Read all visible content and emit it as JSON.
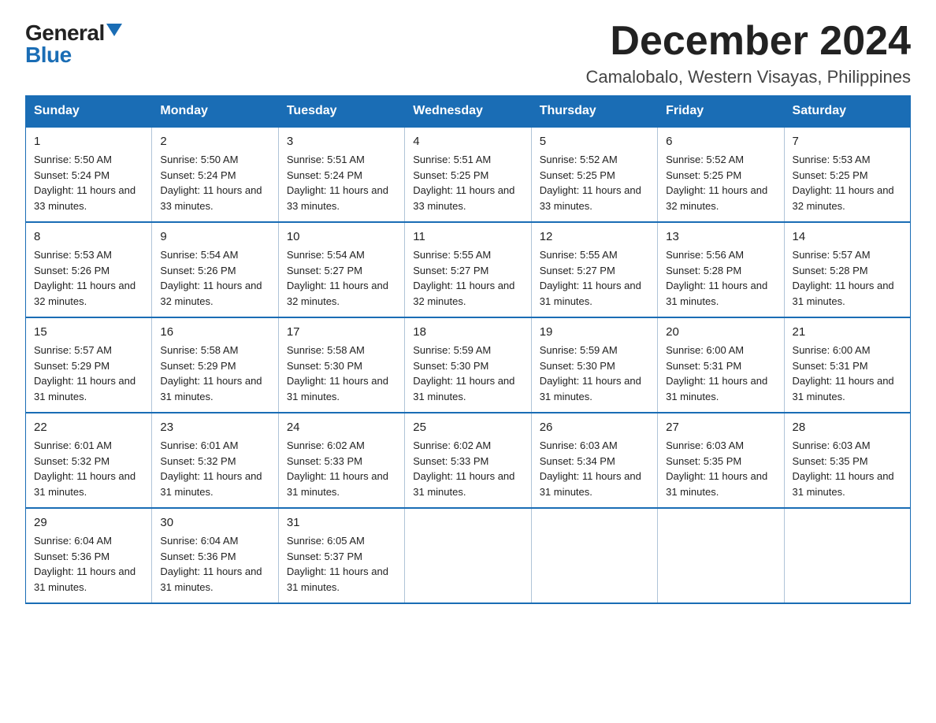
{
  "logo": {
    "general": "General",
    "blue": "Blue",
    "triangle": "▲"
  },
  "title": {
    "month": "December 2024",
    "location": "Camalobalo, Western Visayas, Philippines"
  },
  "weekdays": [
    "Sunday",
    "Monday",
    "Tuesday",
    "Wednesday",
    "Thursday",
    "Friday",
    "Saturday"
  ],
  "weeks": [
    [
      {
        "day": "1",
        "sunrise": "5:50 AM",
        "sunset": "5:24 PM",
        "daylight": "11 hours and 33 minutes."
      },
      {
        "day": "2",
        "sunrise": "5:50 AM",
        "sunset": "5:24 PM",
        "daylight": "11 hours and 33 minutes."
      },
      {
        "day": "3",
        "sunrise": "5:51 AM",
        "sunset": "5:24 PM",
        "daylight": "11 hours and 33 minutes."
      },
      {
        "day": "4",
        "sunrise": "5:51 AM",
        "sunset": "5:25 PM",
        "daylight": "11 hours and 33 minutes."
      },
      {
        "day": "5",
        "sunrise": "5:52 AM",
        "sunset": "5:25 PM",
        "daylight": "11 hours and 33 minutes."
      },
      {
        "day": "6",
        "sunrise": "5:52 AM",
        "sunset": "5:25 PM",
        "daylight": "11 hours and 32 minutes."
      },
      {
        "day": "7",
        "sunrise": "5:53 AM",
        "sunset": "5:25 PM",
        "daylight": "11 hours and 32 minutes."
      }
    ],
    [
      {
        "day": "8",
        "sunrise": "5:53 AM",
        "sunset": "5:26 PM",
        "daylight": "11 hours and 32 minutes."
      },
      {
        "day": "9",
        "sunrise": "5:54 AM",
        "sunset": "5:26 PM",
        "daylight": "11 hours and 32 minutes."
      },
      {
        "day": "10",
        "sunrise": "5:54 AM",
        "sunset": "5:27 PM",
        "daylight": "11 hours and 32 minutes."
      },
      {
        "day": "11",
        "sunrise": "5:55 AM",
        "sunset": "5:27 PM",
        "daylight": "11 hours and 32 minutes."
      },
      {
        "day": "12",
        "sunrise": "5:55 AM",
        "sunset": "5:27 PM",
        "daylight": "11 hours and 31 minutes."
      },
      {
        "day": "13",
        "sunrise": "5:56 AM",
        "sunset": "5:28 PM",
        "daylight": "11 hours and 31 minutes."
      },
      {
        "day": "14",
        "sunrise": "5:57 AM",
        "sunset": "5:28 PM",
        "daylight": "11 hours and 31 minutes."
      }
    ],
    [
      {
        "day": "15",
        "sunrise": "5:57 AM",
        "sunset": "5:29 PM",
        "daylight": "11 hours and 31 minutes."
      },
      {
        "day": "16",
        "sunrise": "5:58 AM",
        "sunset": "5:29 PM",
        "daylight": "11 hours and 31 minutes."
      },
      {
        "day": "17",
        "sunrise": "5:58 AM",
        "sunset": "5:30 PM",
        "daylight": "11 hours and 31 minutes."
      },
      {
        "day": "18",
        "sunrise": "5:59 AM",
        "sunset": "5:30 PM",
        "daylight": "11 hours and 31 minutes."
      },
      {
        "day": "19",
        "sunrise": "5:59 AM",
        "sunset": "5:30 PM",
        "daylight": "11 hours and 31 minutes."
      },
      {
        "day": "20",
        "sunrise": "6:00 AM",
        "sunset": "5:31 PM",
        "daylight": "11 hours and 31 minutes."
      },
      {
        "day": "21",
        "sunrise": "6:00 AM",
        "sunset": "5:31 PM",
        "daylight": "11 hours and 31 minutes."
      }
    ],
    [
      {
        "day": "22",
        "sunrise": "6:01 AM",
        "sunset": "5:32 PM",
        "daylight": "11 hours and 31 minutes."
      },
      {
        "day": "23",
        "sunrise": "6:01 AM",
        "sunset": "5:32 PM",
        "daylight": "11 hours and 31 minutes."
      },
      {
        "day": "24",
        "sunrise": "6:02 AM",
        "sunset": "5:33 PM",
        "daylight": "11 hours and 31 minutes."
      },
      {
        "day": "25",
        "sunrise": "6:02 AM",
        "sunset": "5:33 PM",
        "daylight": "11 hours and 31 minutes."
      },
      {
        "day": "26",
        "sunrise": "6:03 AM",
        "sunset": "5:34 PM",
        "daylight": "11 hours and 31 minutes."
      },
      {
        "day": "27",
        "sunrise": "6:03 AM",
        "sunset": "5:35 PM",
        "daylight": "11 hours and 31 minutes."
      },
      {
        "day": "28",
        "sunrise": "6:03 AM",
        "sunset": "5:35 PM",
        "daylight": "11 hours and 31 minutes."
      }
    ],
    [
      {
        "day": "29",
        "sunrise": "6:04 AM",
        "sunset": "5:36 PM",
        "daylight": "11 hours and 31 minutes."
      },
      {
        "day": "30",
        "sunrise": "6:04 AM",
        "sunset": "5:36 PM",
        "daylight": "11 hours and 31 minutes."
      },
      {
        "day": "31",
        "sunrise": "6:05 AM",
        "sunset": "5:37 PM",
        "daylight": "11 hours and 31 minutes."
      },
      null,
      null,
      null,
      null
    ]
  ],
  "labels": {
    "sunrise": "Sunrise: ",
    "sunset": "Sunset: ",
    "daylight": "Daylight: "
  }
}
